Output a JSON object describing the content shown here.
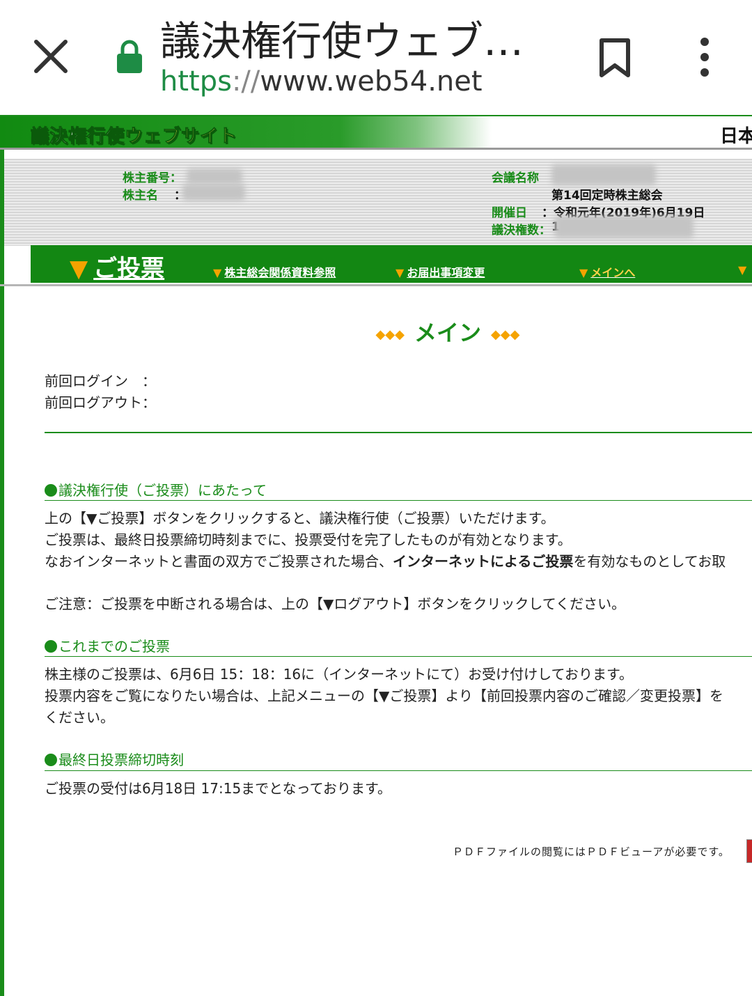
{
  "browser": {
    "title": "議決権行使ウェブサ…",
    "url_scheme": "https",
    "url_sep": "://",
    "url_host": "www.web54.net"
  },
  "header": {
    "logo_part1": "議決権行使",
    "logo_part2": "ウェブサイト",
    "language": "日本"
  },
  "info": {
    "shareholder_number_label": "株主番号：",
    "shareholder_name_label": "株主名",
    "shareholder_name_colon": "：",
    "meeting_name_label": "会議名称",
    "meeting_name_value": "第14回定時株主総会",
    "date_label": "開催日",
    "date_value": "：令和元年(2019年)6月19日",
    "votes_label": "議決権数：",
    "votes_value_prefix": "1"
  },
  "nav": {
    "vote_label": "ご投票",
    "tri": "▼",
    "materials_label": "株主総会関係資料参照",
    "change_label": "お届出事項変更",
    "main_label": "メインへ"
  },
  "main": {
    "heading": "メイン",
    "diamonds": "◆◆◆",
    "last_login_label": "前回ログイン　：",
    "last_logout_label": "前回ログアウト：",
    "section1": {
      "title": "議決権行使（ご投票）にあたって",
      "line1": "上の【▼ご投票】ボタンをクリックすると、議決権行使（ご投票）いただけます。",
      "line2": "ご投票は、最終日投票締切時刻までに、投票受付を完了したものが有効となります。",
      "line3_pre": "なおインターネットと書面の双方でご投票された場合、",
      "line3_bold": "インターネットによるご投票",
      "line3_post": "を有効なものとしてお取",
      "notice": "ご注意：ご投票を中断される場合は、上の【▼ログアウト】ボタンをクリックしてください。"
    },
    "section2": {
      "title": "これまでのご投票",
      "line1": "株主様のご投票は、6月6日 15：18：16に（インターネットにて）お受け付けしております。",
      "line2": "投票内容をご覧になりたい場合は、上記メニューの【▼ご投票】より【前回投票内容のご確認／変更投票】を",
      "line3": "ください。"
    },
    "section3": {
      "title": "最終日投票締切時刻",
      "line1": "ご投票の受付は6月18日 17:15までとなっております。"
    },
    "pdf_note": "ＰＤＦファイルの閲覧にはＰＤＦビューアが必要です。"
  }
}
